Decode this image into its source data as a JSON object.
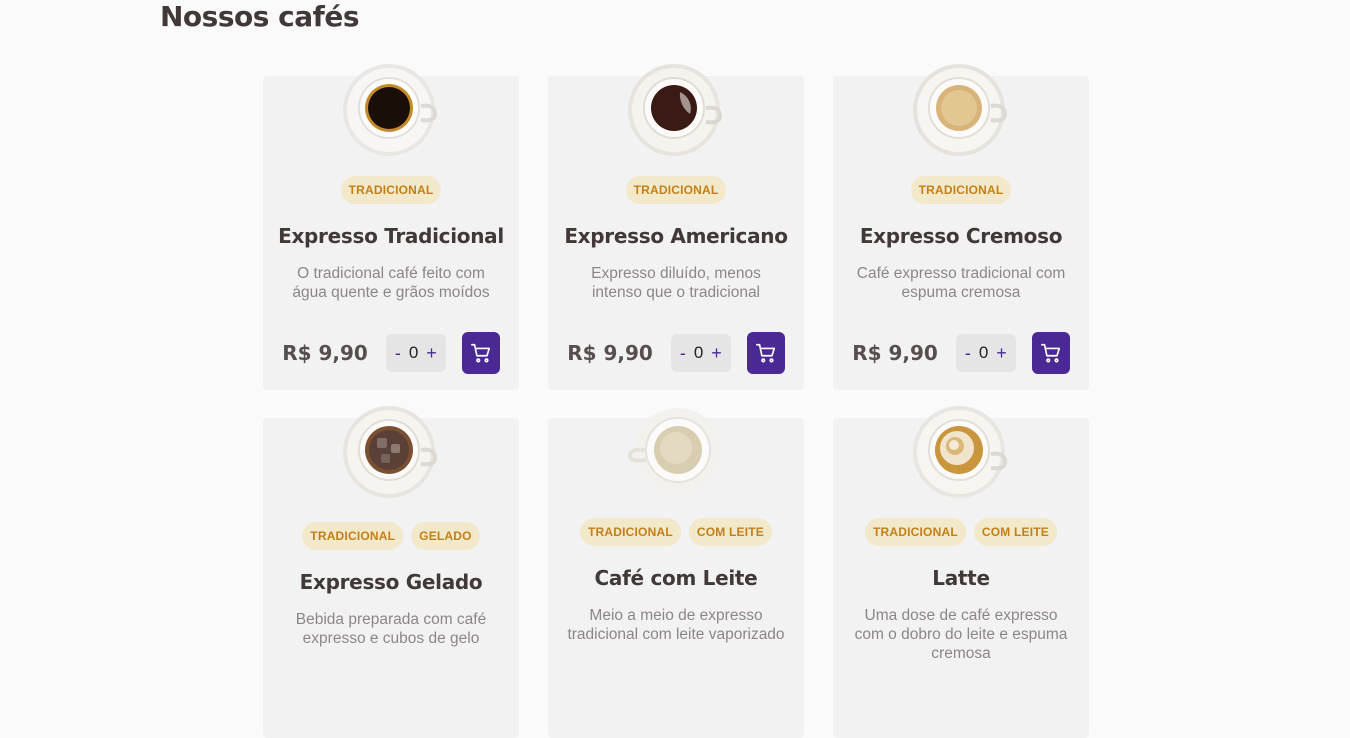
{
  "page": {
    "title": "Nossos cafés"
  },
  "colors": {
    "accent": "#4b2995",
    "tag_bg": "#f1e9c9",
    "tag_text": "#c47f17"
  },
  "products": [
    {
      "tags": [
        "TRADICIONAL"
      ],
      "name": "Expresso Tradicional",
      "description": "O tradicional café feito com água quente e grãos moídos",
      "price": "R$ 9,90",
      "quantity": "0",
      "minus": "-",
      "plus": "+",
      "image": "cup-black-coffee"
    },
    {
      "tags": [
        "TRADICIONAL"
      ],
      "name": "Expresso Americano",
      "description": "Expresso diluído, menos intenso que o tradicional",
      "price": "R$ 9,90",
      "quantity": "0",
      "minus": "-",
      "plus": "+",
      "image": "cup-americano"
    },
    {
      "tags": [
        "TRADICIONAL"
      ],
      "name": "Expresso Cremoso",
      "description": "Café expresso tradicional com espuma cremosa",
      "price": "R$ 9,90",
      "quantity": "0",
      "minus": "-",
      "plus": "+",
      "image": "cup-cremoso"
    },
    {
      "tags": [
        "TRADICIONAL",
        "GELADO"
      ],
      "name": "Expresso Gelado",
      "description": "Bebida preparada com café expresso e cubos de gelo",
      "image": "cup-iced"
    },
    {
      "tags": [
        "TRADICIONAL",
        "COM LEITE"
      ],
      "name": "Café com Leite",
      "description": "Meio a meio de expresso tradicional com leite vaporizado",
      "image": "cup-latte-milk"
    },
    {
      "tags": [
        "TRADICIONAL",
        "COM LEITE"
      ],
      "name": "Latte",
      "description": "Uma dose de café expresso com o dobro do leite e espuma cremosa",
      "image": "cup-latte-art"
    }
  ]
}
